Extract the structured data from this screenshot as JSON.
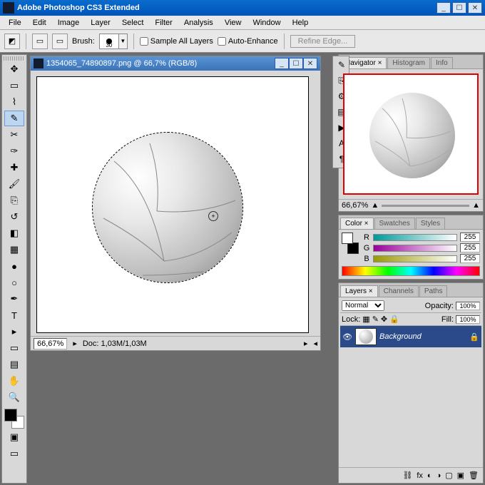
{
  "window": {
    "title": "Adobe Photoshop CS3 Extended"
  },
  "menu": [
    "File",
    "Edit",
    "Image",
    "Layer",
    "Select",
    "Filter",
    "Analysis",
    "View",
    "Window",
    "Help"
  ],
  "options": {
    "brush_label": "Brush:",
    "brush_size": "30",
    "sample_all": "Sample All Layers",
    "auto_enhance": "Auto-Enhance",
    "refine_edge": "Refine Edge..."
  },
  "document": {
    "title": "1354065_74890897.png @ 66,7% (RGB/8)",
    "zoom": "66,67%",
    "doc_info": "Doc: 1,03M/1,03M"
  },
  "navigator": {
    "tabs": [
      "Navigator ×",
      "Histogram",
      "Info"
    ],
    "zoom": "66,67%"
  },
  "color": {
    "tabs": [
      "Color ×",
      "Swatches",
      "Styles"
    ],
    "channels": [
      {
        "label": "R",
        "value": "255",
        "grad": "linear-gradient(to right,#099,#fff)"
      },
      {
        "label": "G",
        "value": "255",
        "grad": "linear-gradient(to right,#909,#fff)"
      },
      {
        "label": "B",
        "value": "255",
        "grad": "linear-gradient(to right,#990,#fff)"
      }
    ]
  },
  "layers": {
    "tabs": [
      "Layers ×",
      "Channels",
      "Paths"
    ],
    "blend_mode": "Normal",
    "opacity_label": "Opacity:",
    "opacity": "100%",
    "lock_label": "Lock:",
    "fill_label": "Fill:",
    "fill": "100%",
    "items": [
      {
        "name": "Background"
      }
    ]
  }
}
